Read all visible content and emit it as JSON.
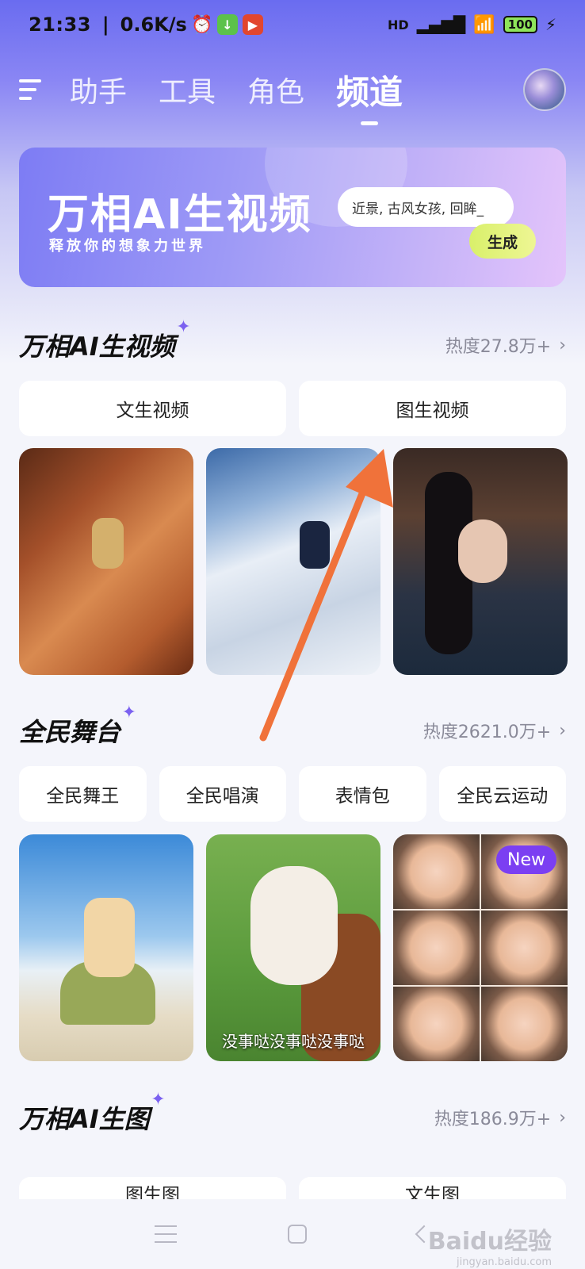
{
  "status_bar": {
    "time": "21:33",
    "separator": "|",
    "speed": "0.6K/s",
    "network": "HD",
    "battery": "100"
  },
  "nav": {
    "tabs": [
      {
        "label": "助手"
      },
      {
        "label": "工具"
      },
      {
        "label": "角色"
      },
      {
        "label": "频道"
      }
    ],
    "active_tab": "频道"
  },
  "banner": {
    "title": "万相AI生视频",
    "subtitle": "释放你的想象力世界",
    "prompt": "近景, 古风女孩, 回眸_",
    "button": "生成"
  },
  "sections": [
    {
      "title": "万相AI生视频",
      "heat": "热度27.8万+",
      "pills": [
        "文生视频",
        "图生视频"
      ]
    },
    {
      "title": "全民舞台",
      "heat": "热度2621.0万+",
      "pills": [
        "全民舞王",
        "全民唱演",
        "表情包",
        "全民云运动"
      ],
      "card_caption": "没事哒没事哒没事哒",
      "badge": "New"
    },
    {
      "title": "万相AI生图",
      "heat": "热度186.9万+",
      "pills": [
        "图生图",
        "文生图"
      ]
    }
  ],
  "chevron": "›",
  "watermark": {
    "text": "Baidu经验",
    "url": "jingyan.baidu.com"
  },
  "colors": {
    "accent": "#7b61f0",
    "arrow": "#f0723a",
    "button_lime": "#d9f06a"
  }
}
